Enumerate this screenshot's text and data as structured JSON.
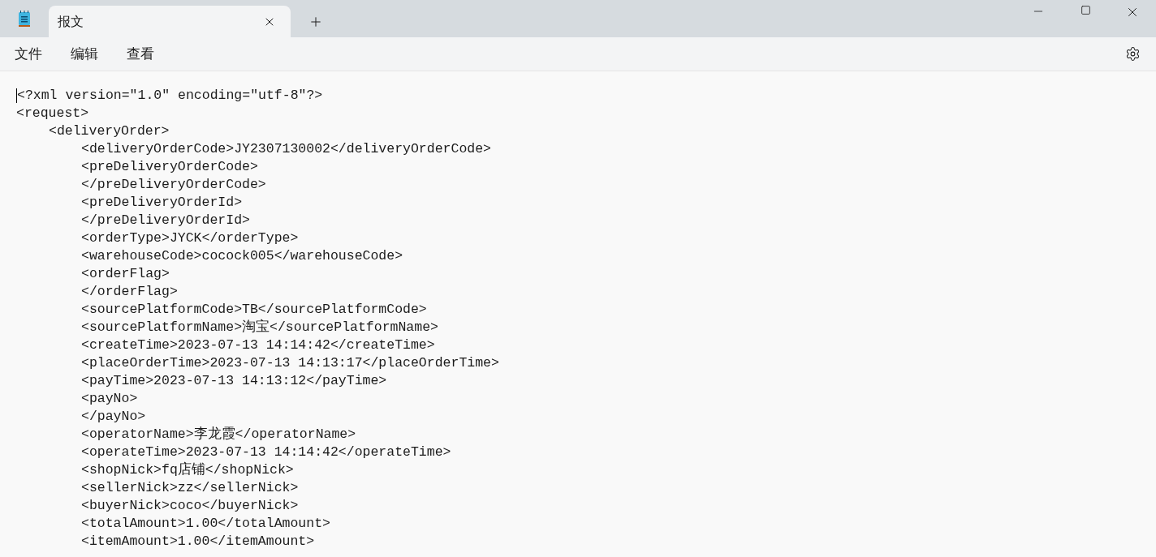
{
  "tab": {
    "title": "报文",
    "selected": true
  },
  "menu": [
    "文件",
    "编辑",
    "查看"
  ],
  "lines": [
    {
      "text": "<?xml version=\"1.0\" encoding=\"utf-8\"?>"
    },
    {
      "text": "<request>",
      "children": [
        {
          "text": "<deliveryOrder>",
          "children": [
            {
              "text": "<deliveryOrderCode>JY2307130002</deliveryOrderCode>"
            },
            {
              "text": "<preDeliveryOrderCode>"
            },
            {
              "text": "</preDeliveryOrderCode>"
            },
            {
              "text": "<preDeliveryOrderId>"
            },
            {
              "text": "</preDeliveryOrderId>"
            },
            {
              "text": "<orderType>JYCK</orderType>"
            },
            {
              "text": "<warehouseCode>cocock005</warehouseCode>"
            },
            {
              "text": "<orderFlag>"
            },
            {
              "text": "</orderFlag>"
            },
            {
              "text": "<sourcePlatformCode>TB</sourcePlatformCode>"
            },
            {
              "text": "<sourcePlatformName>淘宝</sourcePlatformName>"
            },
            {
              "text": "<createTime>2023-07-13 14:14:42</createTime>"
            },
            {
              "text": "<placeOrderTime>2023-07-13 14:13:17</placeOrderTime>"
            },
            {
              "text": "<payTime>2023-07-13 14:13:12</payTime>"
            },
            {
              "text": "<payNo>"
            },
            {
              "text": "</payNo>"
            },
            {
              "text": "<operatorName>李龙霞</operatorName>"
            },
            {
              "text": "<operateTime>2023-07-13 14:14:42</operateTime>"
            },
            {
              "text": "<shopNick>fq店铺</shopNick>"
            },
            {
              "text": "<sellerNick>zz</sellerNick>"
            },
            {
              "text": "<buyerNick>coco</buyerNick>"
            },
            {
              "text": "<totalAmount>1.00</totalAmount>"
            },
            {
              "text": "<itemAmount>1.00</itemAmount>"
            }
          ]
        }
      ]
    }
  ]
}
